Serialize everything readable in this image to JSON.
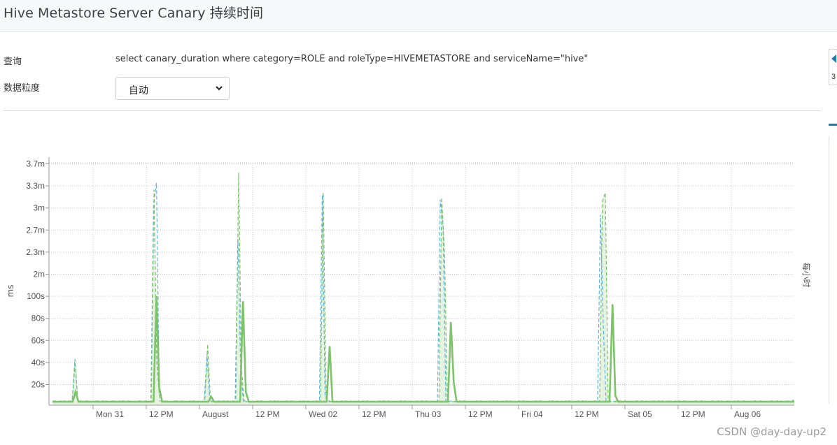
{
  "page": {
    "title": "Hive Metastore Server Canary 持续时间"
  },
  "form": {
    "query_label": "查询",
    "query_text": "select canary_duration where category=ROLE and roleType=HIVEMETASTORE and serviceName=\"hive\"",
    "granularity_label": "数据粒度",
    "granularity_value": "自动"
  },
  "side_panel": {
    "number": "3"
  },
  "watermark": "CSDN @day-day-up2",
  "chart_data": {
    "type": "line",
    "ylabel": "ms",
    "right_label": "每小时",
    "y_ticks": [
      "20s",
      "40s",
      "60s",
      "80s",
      "100s",
      "2m",
      "2.3m",
      "2.7m",
      "3m",
      "3.3m",
      "3.7m"
    ],
    "x_ticks": [
      "Mon 31",
      "12 PM",
      "August",
      "12 PM",
      "Wed 02",
      "12 PM",
      "Thu 03",
      "12 PM",
      "Fri 04",
      "12 PM",
      "Sat 05",
      "12 PM",
      "Aug 06"
    ],
    "grid": true,
    "colors": {
      "mean": "#7cc36a",
      "max_dashed": "#7cc36a",
      "blue": "#5ab4e6",
      "fill": "#e3f2df"
    },
    "series": [
      {
        "values": [
          2,
          2,
          2,
          2,
          2,
          2,
          2,
          2,
          12,
          2,
          2,
          2,
          2,
          2,
          2,
          2,
          2,
          2,
          2,
          2,
          2,
          2,
          2,
          2,
          2,
          2,
          2,
          2,
          2,
          2,
          2,
          2,
          2,
          2,
          2,
          2,
          108,
          16,
          2,
          2,
          2,
          2,
          2,
          2,
          2,
          2,
          2,
          2,
          2,
          2,
          2,
          2,
          2,
          2,
          2,
          7,
          2,
          2,
          2,
          2,
          2,
          2,
          2,
          2,
          2,
          2,
          103,
          12,
          2,
          2,
          2,
          2,
          2,
          2,
          2,
          2,
          2,
          2,
          2,
          2,
          2,
          2,
          2,
          2,
          2,
          2,
          2,
          2,
          2,
          2,
          2,
          2,
          2,
          2,
          2,
          2,
          58,
          2,
          2,
          2,
          2,
          2,
          2,
          2,
          2,
          2,
          2,
          2,
          2,
          2,
          2,
          2,
          2,
          2,
          2,
          2,
          2,
          2,
          2,
          2,
          2,
          2,
          2,
          2,
          2,
          2,
          2,
          2,
          2,
          2,
          2,
          2,
          2,
          2,
          2,
          2,
          2,
          2,
          82,
          22,
          2,
          2,
          2,
          2,
          2,
          2,
          2,
          2,
          2,
          2,
          2,
          2,
          2,
          2,
          2,
          2,
          2,
          2,
          2,
          2,
          2,
          2,
          2,
          2,
          2,
          2,
          2,
          2,
          2,
          2,
          2,
          2,
          2,
          2,
          2,
          2,
          2,
          2,
          2,
          2,
          2,
          2,
          2,
          2,
          2,
          2,
          2,
          2,
          2,
          2,
          2,
          2,
          2,
          2,
          100,
          8,
          2,
          2,
          2,
          2,
          2,
          2,
          2,
          2,
          2,
          2,
          2,
          2,
          2,
          2,
          2,
          2,
          2,
          2,
          2,
          2,
          2,
          2,
          2,
          2,
          2,
          2,
          2,
          2,
          2,
          2,
          2,
          2,
          2,
          2,
          2,
          2,
          2,
          2,
          2,
          2,
          2,
          2,
          2,
          2,
          2,
          2,
          2,
          2,
          2,
          2,
          2,
          2,
          2,
          2,
          2,
          2,
          2,
          2,
          2,
          2,
          2,
          2
        ]
      },
      {
        "values": [
          3,
          2,
          2,
          3,
          2,
          2,
          3,
          2,
          42,
          3,
          2,
          2,
          3,
          2,
          2,
          3,
          2,
          2,
          3,
          2,
          2,
          3,
          2,
          2,
          3,
          2,
          2,
          3,
          2,
          2,
          3,
          2,
          2,
          3,
          2,
          2,
          215,
          40,
          3,
          2,
          2,
          3,
          2,
          2,
          3,
          2,
          2,
          3,
          2,
          2,
          3,
          2,
          2,
          3,
          2,
          60,
          3,
          2,
          2,
          3,
          2,
          2,
          3,
          2,
          2,
          3,
          232,
          35,
          3,
          2,
          2,
          3,
          2,
          2,
          3,
          2,
          2,
          3,
          2,
          2,
          3,
          2,
          2,
          3,
          2,
          2,
          3,
          2,
          2,
          3,
          2,
          2,
          3,
          2,
          2,
          3,
          212,
          6,
          3,
          2,
          2,
          3,
          2,
          2,
          3,
          2,
          2,
          3,
          2,
          2,
          3,
          2,
          2,
          3,
          2,
          2,
          3,
          2,
          2,
          3,
          2,
          2,
          3,
          2,
          2,
          3,
          2,
          2,
          3,
          2,
          2,
          3,
          2,
          2,
          3,
          2,
          2,
          3,
          207,
          150,
          3,
          2,
          2,
          3,
          2,
          2,
          3,
          2,
          2,
          3,
          2,
          2,
          3,
          2,
          2,
          3,
          2,
          2,
          3,
          2,
          2,
          3,
          2,
          2,
          3,
          2,
          2,
          3,
          2,
          2,
          3,
          2,
          2,
          3,
          2,
          2,
          3,
          2,
          2,
          3,
          2,
          2,
          3,
          2,
          2,
          3,
          2,
          2,
          3,
          2,
          2,
          3,
          2,
          2,
          3,
          204,
          212,
          3,
          2,
          2,
          3,
          2,
          2,
          3,
          2,
          2,
          3,
          2,
          2,
          3,
          2,
          2,
          3,
          2,
          2,
          3,
          2,
          2,
          3,
          2,
          2,
          3,
          2,
          2,
          3,
          2,
          2,
          3,
          2,
          2,
          3,
          2,
          2,
          3,
          2,
          2,
          3,
          2,
          2,
          3,
          2,
          2,
          3,
          2,
          2,
          3,
          2,
          2,
          3,
          2,
          2,
          3,
          2,
          2,
          3,
          2,
          2,
          3,
          2,
          2,
          3,
          2,
          2,
          3
        ]
      },
      {
        "values": [
          2,
          3,
          2,
          2,
          3,
          2,
          2,
          3,
          45,
          2,
          3,
          2,
          2,
          3,
          2,
          2,
          3,
          2,
          2,
          3,
          2,
          2,
          3,
          2,
          2,
          3,
          2,
          2,
          3,
          2,
          2,
          3,
          2,
          2,
          3,
          2,
          200,
          222,
          12,
          2,
          3,
          2,
          2,
          3,
          2,
          2,
          3,
          2,
          2,
          3,
          2,
          2,
          3,
          2,
          2,
          50,
          2,
          2,
          3,
          2,
          2,
          3,
          2,
          2,
          3,
          2,
          165,
          30,
          2,
          2,
          3,
          2,
          2,
          3,
          2,
          2,
          3,
          2,
          2,
          3,
          2,
          2,
          3,
          2,
          2,
          3,
          2,
          2,
          3,
          2,
          2,
          3,
          2,
          2,
          3,
          2,
          210,
          8,
          2,
          2,
          3,
          2,
          2,
          3,
          2,
          2,
          3,
          2,
          2,
          3,
          2,
          2,
          3,
          2,
          2,
          3,
          2,
          2,
          3,
          2,
          2,
          3,
          2,
          2,
          3,
          2,
          2,
          3,
          2,
          2,
          3,
          2,
          2,
          3,
          2,
          2,
          3,
          2,
          205,
          180,
          2,
          2,
          3,
          2,
          2,
          3,
          2,
          2,
          3,
          2,
          2,
          3,
          2,
          2,
          3,
          2,
          2,
          3,
          2,
          2,
          3,
          2,
          2,
          3,
          2,
          2,
          3,
          2,
          2,
          3,
          2,
          2,
          3,
          2,
          2,
          3,
          2,
          2,
          3,
          2,
          2,
          3,
          2,
          2,
          3,
          2,
          2,
          3,
          2,
          2,
          3,
          2,
          2,
          3,
          2,
          190,
          80,
          2,
          2,
          3,
          2,
          2,
          3,
          2,
          2,
          3,
          2,
          2,
          3,
          2,
          2,
          3,
          2,
          2,
          3,
          2,
          2,
          3,
          2,
          2,
          3,
          2,
          2,
          3,
          2,
          2,
          3,
          2,
          2,
          3,
          2,
          2,
          3,
          2,
          2,
          3,
          2,
          2,
          3,
          2,
          2,
          3,
          2,
          2,
          3,
          2,
          2,
          3,
          2,
          2,
          3,
          2,
          2,
          3,
          2,
          2,
          3,
          2,
          2,
          3,
          2,
          2,
          3,
          2,
          5
        ]
      }
    ]
  }
}
